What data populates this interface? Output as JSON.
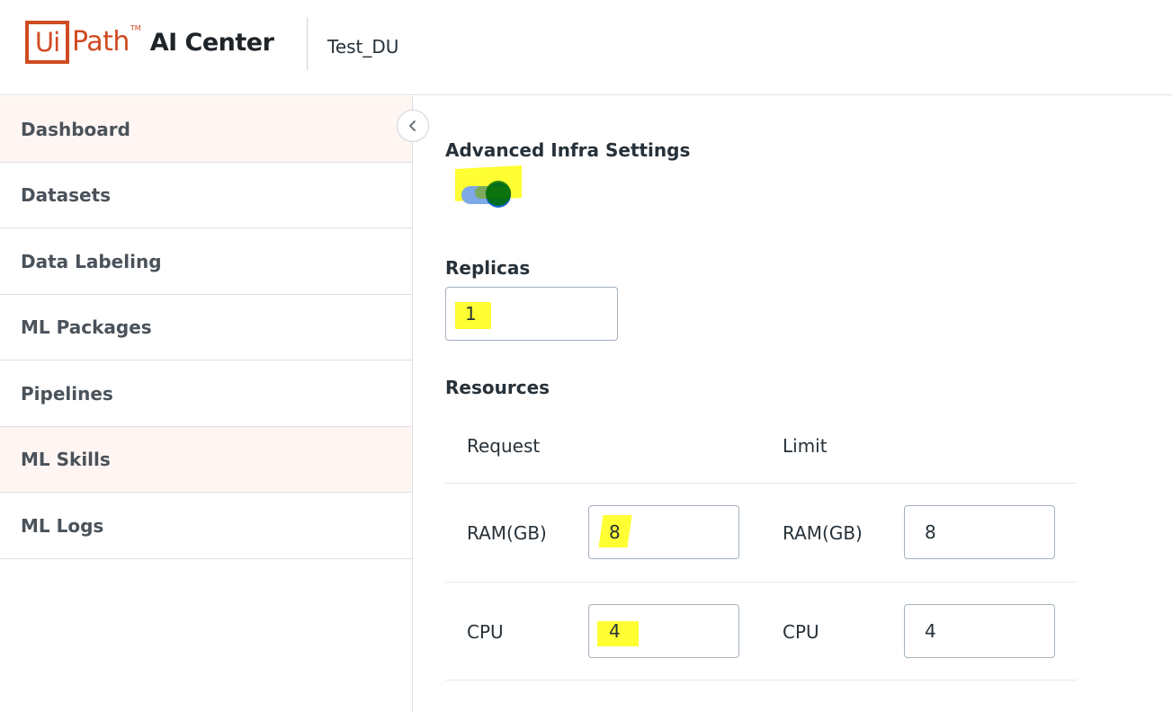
{
  "header": {
    "logo_ui": "Ui",
    "logo_path": "Path",
    "logo_tm": "TM",
    "product": "AI Center",
    "tenant": "Test_DU"
  },
  "sidebar": {
    "items": [
      {
        "label": "Dashboard"
      },
      {
        "label": "Datasets"
      },
      {
        "label": "Data Labeling"
      },
      {
        "label": "ML Packages"
      },
      {
        "label": "Pipelines"
      },
      {
        "label": "ML Skills"
      },
      {
        "label": "ML Logs"
      }
    ],
    "collapse_icon": "chevron-left-icon"
  },
  "main": {
    "advanced_title": "Advanced Infra Settings",
    "advanced_enabled": true,
    "replicas_label": "Replicas",
    "replicas_value": "1",
    "resources_label": "Resources",
    "request_header": "Request",
    "limit_header": "Limit",
    "ram_label": "RAM(GB)",
    "cpu_label": "CPU",
    "request_ram": "8",
    "request_cpu": "4",
    "limit_ram": "8",
    "limit_cpu": "4"
  },
  "colors": {
    "brand": "#cf4b22",
    "toggle_on": "#1665d8",
    "highlight": "#ffff33",
    "sidebar_active_bg": "#fff6f3"
  }
}
